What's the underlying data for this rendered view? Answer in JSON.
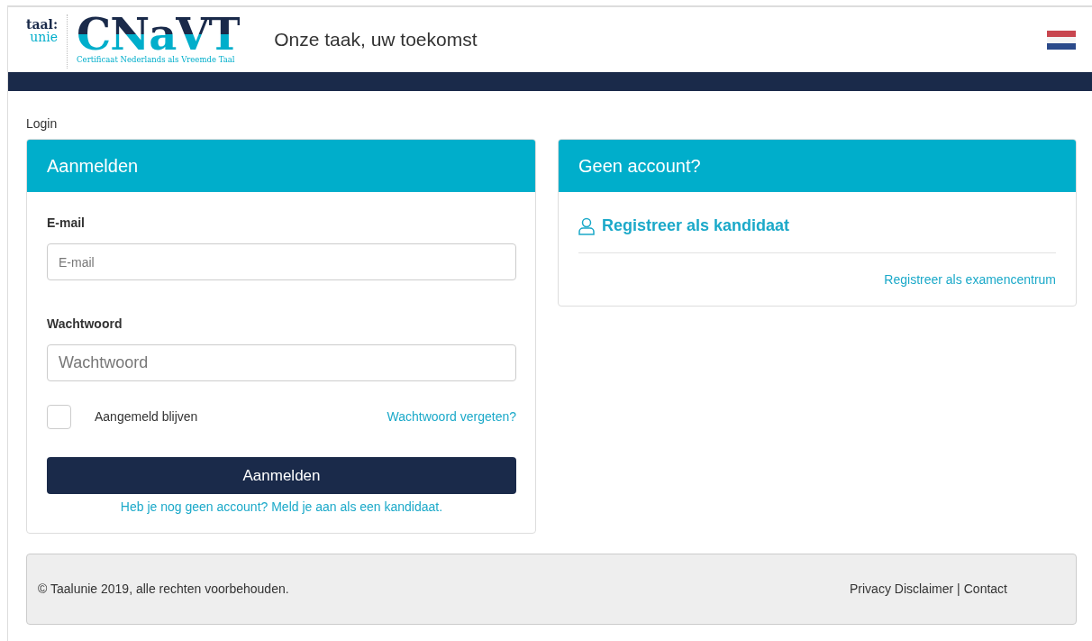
{
  "header": {
    "logo": {
      "brand_top": "taal:",
      "brand_bottom": "unie",
      "title": "CNaVT",
      "subtitle": "Certificaat Nederlands als Vreemde Taal"
    },
    "tagline": "Onze taak, uw toekomst"
  },
  "breadcrumb": "Login",
  "login_card": {
    "title": "Aanmelden",
    "fields": [
      {
        "label": "E-mail",
        "placeholder": "E-mail",
        "kind": "email"
      },
      {
        "label": "Wachtwoord",
        "placeholder": "Wachtwoord",
        "kind": "password"
      }
    ],
    "remember": {
      "label": "Aangemeld blijven",
      "checked": false
    },
    "forgot_link": "Wachtwoord vergeten?",
    "submit": "Aanmelden",
    "register_link": "Heb je nog geen account? Meld je aan als een kandidaat."
  },
  "register_card": {
    "title": "Geen account?",
    "candidate_link": "Registreer als kandidaat",
    "centre_link": "Registreer als examencentrum"
  },
  "footer": {
    "copyright": "© Taalunie 2019, alle rechten voorbehouden.",
    "links": [
      "Privacy Disclaimer",
      "Contact"
    ],
    "separator": "|"
  }
}
